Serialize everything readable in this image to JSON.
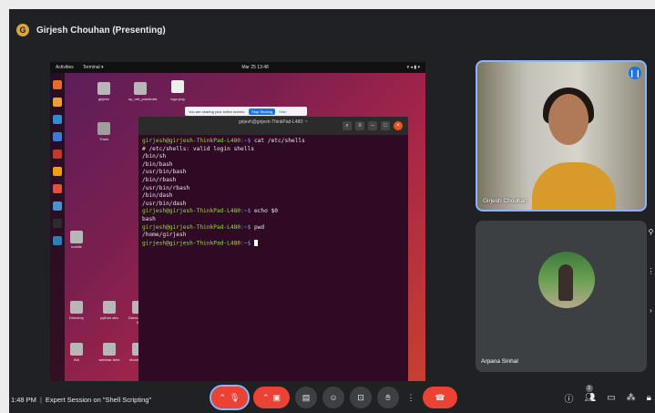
{
  "header": {
    "presenter_label": "Girjesh Chouhan (Presenting)",
    "avatar_letter": "G"
  },
  "shared_screen": {
    "topbar": {
      "activities": "Activities",
      "terminal_menu": "Terminal ▾",
      "clock": "Mar 25 13:48",
      "tray": "▾ ◂ ▮ ▾"
    },
    "share_banner": {
      "message": "You are sharing your entire screen.",
      "stop_label": "Stop Sharing",
      "hide_label": "Hide"
    },
    "terminal": {
      "title": "girjesh@girjesh-ThinkPad-L480: ~",
      "lines": [
        {
          "prompt_user": "girjesh@girjesh-ThinkPad-L480",
          "prompt_path": ":~$",
          "text": " cat /etc/shells"
        },
        {
          "text": "# /etc/shells: valid login shells"
        },
        {
          "text": "/bin/sh"
        },
        {
          "text": "/bin/bash"
        },
        {
          "text": "/usr/bin/bash"
        },
        {
          "text": "/bin/rbash"
        },
        {
          "text": "/usr/bin/rbash"
        },
        {
          "text": "/bin/dash"
        },
        {
          "text": "/usr/bin/dash"
        },
        {
          "prompt_user": "girjesh@girjesh-ThinkPad-L480",
          "prompt_path": ":~$",
          "text": " echo $0"
        },
        {
          "text": "bash"
        },
        {
          "prompt_user": "girjesh@girjesh-ThinkPad-L480",
          "prompt_path": ":~$",
          "text": " pwd"
        },
        {
          "text": "/home/girjesh"
        },
        {
          "prompt_user": "girjesh@girjesh-ThinkPad-L480",
          "prompt_path": ":~$",
          "text": " "
        }
      ]
    },
    "desktop_icons": [
      "girjesh",
      "up_net_practicals",
      "logo.png",
      "Trash",
      "mobile",
      "Bnc",
      "CM",
      "Directory",
      "python atm",
      "Demo 2021-04",
      "W&",
      "webinar-ltrhe",
      "ebook for..."
    ],
    "colors": {
      "dock_icons": [
        "#e66b2f",
        "#f0a030",
        "#2d8bd8",
        "#3b7bd4",
        "#c0392b",
        "#f39c12",
        "#e74c3c",
        "#4a90d9",
        "#e95420",
        "#2980b9"
      ]
    }
  },
  "participants": [
    {
      "name": "Girjesh Chouhan",
      "speaking": true
    },
    {
      "name": "Arpana Sinhal"
    }
  ],
  "footer": {
    "time": "1:48 PM",
    "meeting_title": "Expert Session on \"Shell Scripting\"",
    "people_count": "3",
    "icons": {
      "mic": "mic-off-icon",
      "camera": "camera-off-icon",
      "captions": "captions-icon",
      "emoji": "emoji-icon",
      "present": "present-icon",
      "raise_hand": "hand-icon",
      "more": "more-icon",
      "end_call": "end-call-icon"
    }
  },
  "colors": {
    "accent": "#8ab4f8",
    "danger": "#ea4335",
    "meet_bg": "#202124"
  }
}
